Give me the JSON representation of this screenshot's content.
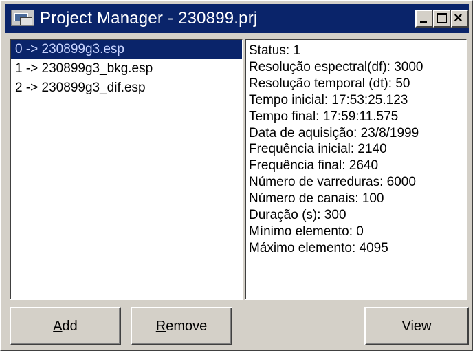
{
  "window": {
    "title": "Project Manager - 230899.prj"
  },
  "file_list": {
    "items": [
      {
        "label": "0 -> 230899g3.esp",
        "selected": true
      },
      {
        "label": "1 -> 230899g3_bkg.esp",
        "selected": false
      },
      {
        "label": "2 -> 230899g3_dif.esp",
        "selected": false
      }
    ]
  },
  "details": {
    "lines": [
      "Status: 1",
      "Resolução espectral(df): 3000",
      "Resolução temporal (dt): 50",
      "Tempo inicial: 17:53:25.123",
      "Tempo final: 17:59:11.575",
      "Data de aquisição: 23/8/1999",
      "Frequência inicial: 2140",
      "Frequência final: 2640",
      "Número de varreduras: 6000",
      "Número de canais: 100",
      "Duração (s): 300",
      "Mínimo elemento: 0",
      "Máximo elemento: 4095"
    ]
  },
  "buttons": {
    "add": {
      "accel": "A",
      "rest": "dd"
    },
    "remove": {
      "accel": "R",
      "rest": "emove"
    },
    "view": "View"
  },
  "colors": {
    "titlebar": "#0a246a",
    "selection": "#0a246a",
    "face": "#d4d0c8"
  }
}
